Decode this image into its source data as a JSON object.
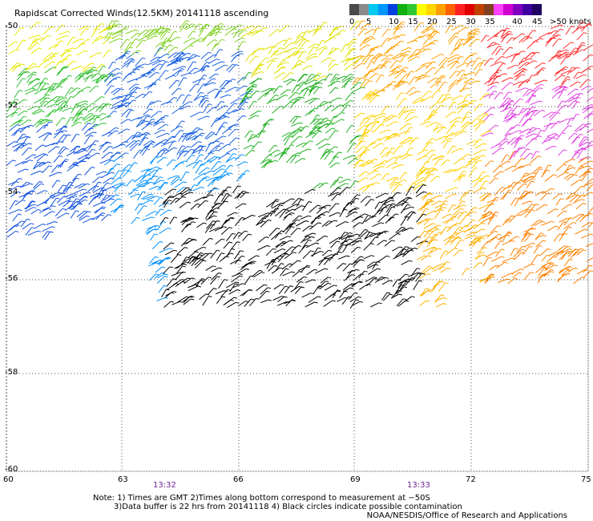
{
  "title": "Rapidscat Corrected Winds(12.5KM) 20141118 ascending",
  "legend": {
    "unit": "knots",
    "labels": [
      "0",
      "5",
      "10",
      "15",
      "20",
      "25",
      "30",
      "35",
      "40",
      "45",
      ">50 knots"
    ],
    "colors": [
      "#4a4a4a",
      "#8a8a8a",
      "#00c8f0",
      "#0096ff",
      "#0040e0",
      "#10b010",
      "#30c830",
      "#ffff00",
      "#ffd700",
      "#ffa000",
      "#ff6000",
      "#ff2020",
      "#e00000",
      "#c04000",
      "#804020",
      "#ff40ff",
      "#d000d0",
      "#8000c0",
      "#4000a0",
      "#200060"
    ]
  },
  "axes": {
    "lat_labels": [
      "-50",
      "-52",
      "-54",
      "-56",
      "-58",
      "-60"
    ],
    "lon_labels": [
      "60",
      "63",
      "66",
      "69",
      "72",
      "75"
    ],
    "time_labels": [
      "13:32",
      "13:33"
    ]
  },
  "notes": {
    "line1": "Note: 1) Times are GMT 2)Times along bottom correspond to measurement at −50S",
    "line2": "3)Data buffer is 22 hrs from 20141118 4) Black circles indicate possible contamination",
    "credit": "NOAA/NESDIS/Office of Research and Applications"
  }
}
